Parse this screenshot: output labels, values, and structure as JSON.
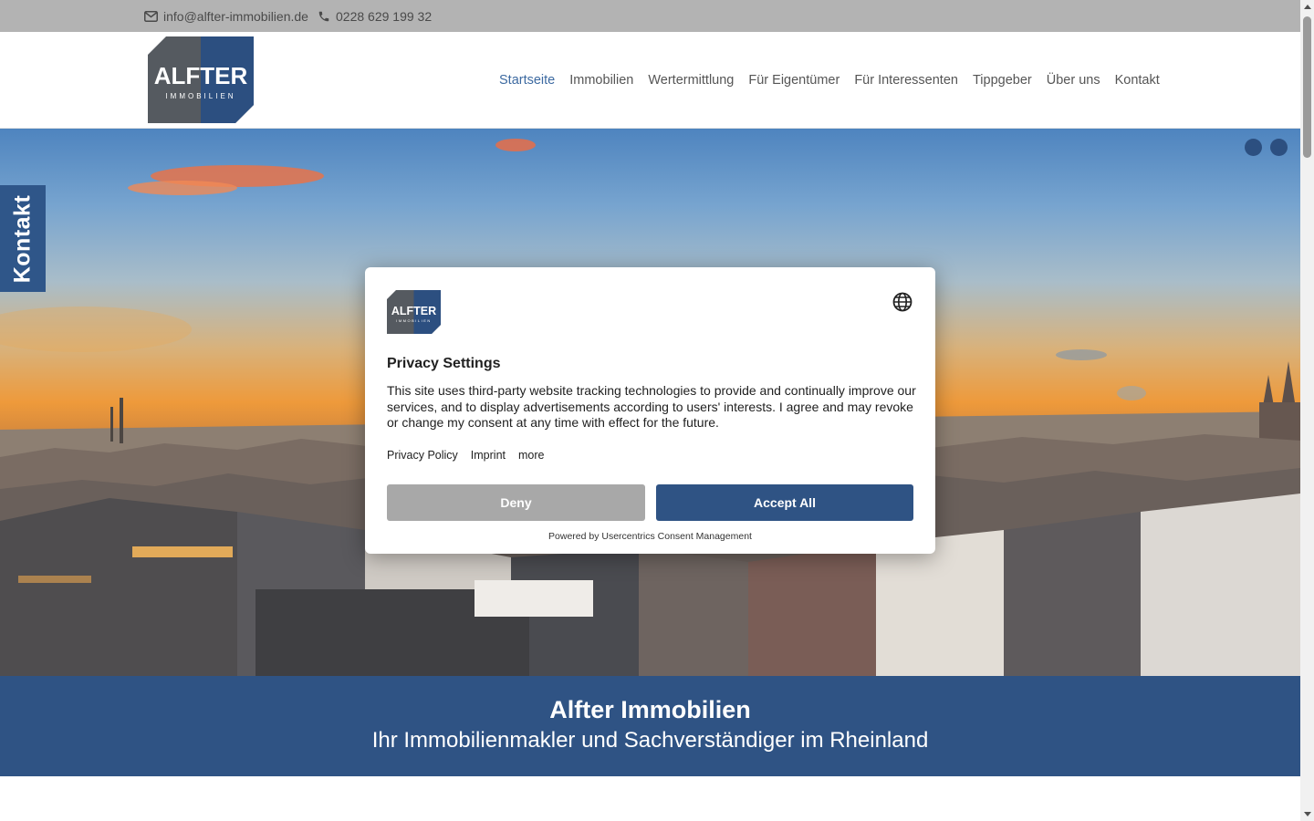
{
  "topbar": {
    "email": "info@alfter-immobilien.de",
    "phone": "0228 629 199 32",
    "email_icon": "envelope-icon",
    "phone_icon": "phone-icon"
  },
  "logo": {
    "line1": "ALFTER",
    "line2": "IMMOBILIEN"
  },
  "nav": {
    "items": [
      "Startseite",
      "Immobilien",
      "Wertermittlung",
      "Für Eigentümer",
      "Für Interessenten",
      "Tippgeber",
      "Über uns",
      "Kontakt"
    ],
    "active": "Startseite",
    "active_color": "#3d6aa1"
  },
  "hero": {
    "slider_dots": 2
  },
  "side_tab": {
    "label": "Kontakt"
  },
  "band": {
    "title": "Alfter Immobilien",
    "subtitle": "Ihr Immobilienmakler und Sachverständiger im Rheinland"
  },
  "consent": {
    "title": "Privacy Settings",
    "description": "This site uses third-party website tracking technologies to provide and continually improve our services, and to display advertisements according to users' interests. I agree and may revoke or change my consent at any time with effect for the future.",
    "links": [
      "Privacy Policy",
      "Imprint",
      "more"
    ],
    "deny_label": "Deny",
    "accept_label": "Accept All",
    "powered_by": "Powered by Usercentrics Consent Management",
    "language_icon": "globe-icon"
  },
  "colors": {
    "brand_blue": "#2f5384",
    "topbar_gray": "#b3b3b3",
    "deny_gray": "#a8a8a8"
  }
}
